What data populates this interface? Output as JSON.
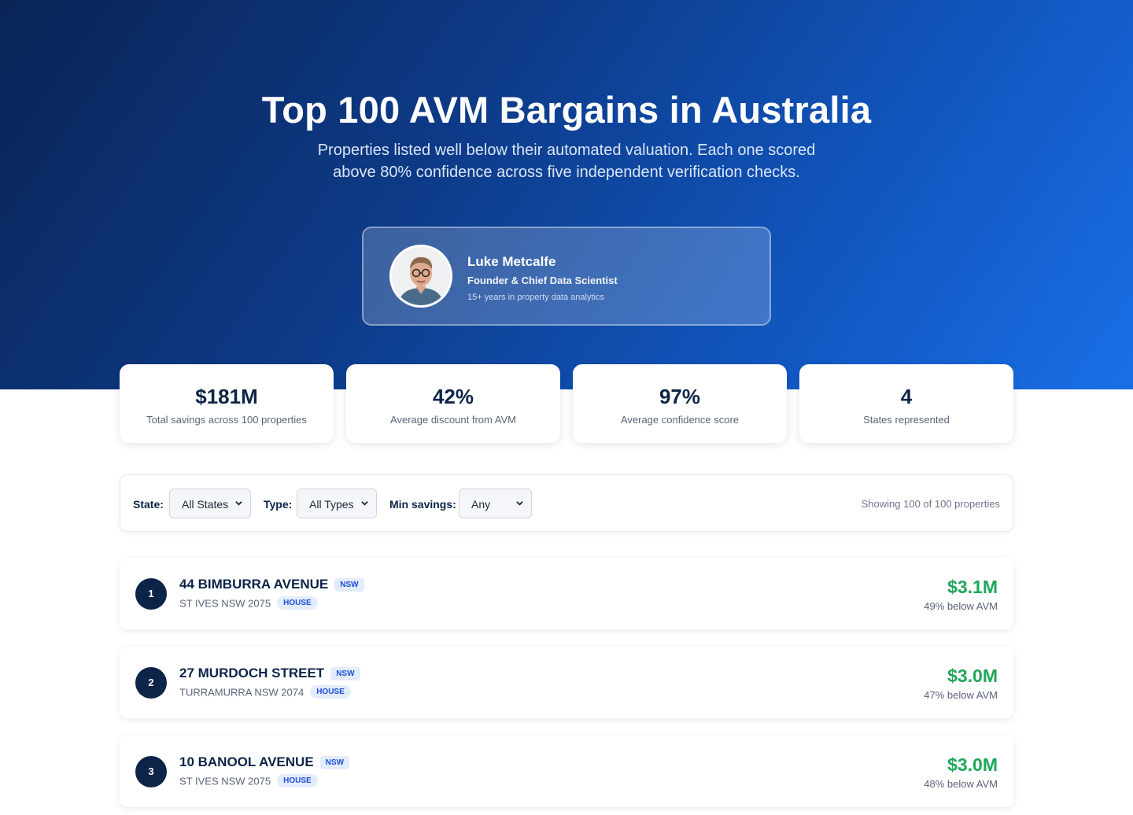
{
  "hero": {
    "title": "Top 100 AVM Bargains in Australia",
    "subtitle": "Properties listed well below their automated valuation. Each one scored above 80% confidence across five independent verification checks."
  },
  "author": {
    "name": "Luke Metcalfe",
    "role": "Founder & Chief Data Scientist",
    "experience": "15+ years in property data analytics",
    "avatar_icon": "person-photo"
  },
  "stats": [
    {
      "value": "$181M",
      "label": "Total savings across 100 properties"
    },
    {
      "value": "42%",
      "label": "Average discount from AVM"
    },
    {
      "value": "97%",
      "label": "Average confidence score"
    },
    {
      "value": "4",
      "label": "States represented"
    }
  ],
  "filters": {
    "state_label": "State:",
    "state_value": "All States",
    "type_label": "Type:",
    "type_value": "All Types",
    "min_savings_label": "Min savings:",
    "min_savings_value": "Any",
    "showing": "Showing 100 of 100 properties"
  },
  "properties": [
    {
      "rank": "1",
      "address": "44 BIMBURRA AVENUE",
      "state": "NSW",
      "suburb": "ST IVES NSW 2075",
      "type": "HOUSE",
      "saving": "$3.1M",
      "below": "49% below AVM"
    },
    {
      "rank": "2",
      "address": "27 MURDOCH STREET",
      "state": "NSW",
      "suburb": "TURRAMURRA NSW 2074",
      "type": "HOUSE",
      "saving": "$3.0M",
      "below": "47% below AVM"
    },
    {
      "rank": "3",
      "address": "10 BANOOL AVENUE",
      "state": "NSW",
      "suburb": "ST IVES NSW 2075",
      "type": "HOUSE",
      "saving": "$3.0M",
      "below": "48% below AVM"
    }
  ],
  "colors": {
    "hero_start": "#0a2456",
    "hero_end": "#1a6fe6",
    "navy": "#0b2447",
    "saving_green": "#20a65a",
    "badge_blue": "#1d4ed8"
  }
}
